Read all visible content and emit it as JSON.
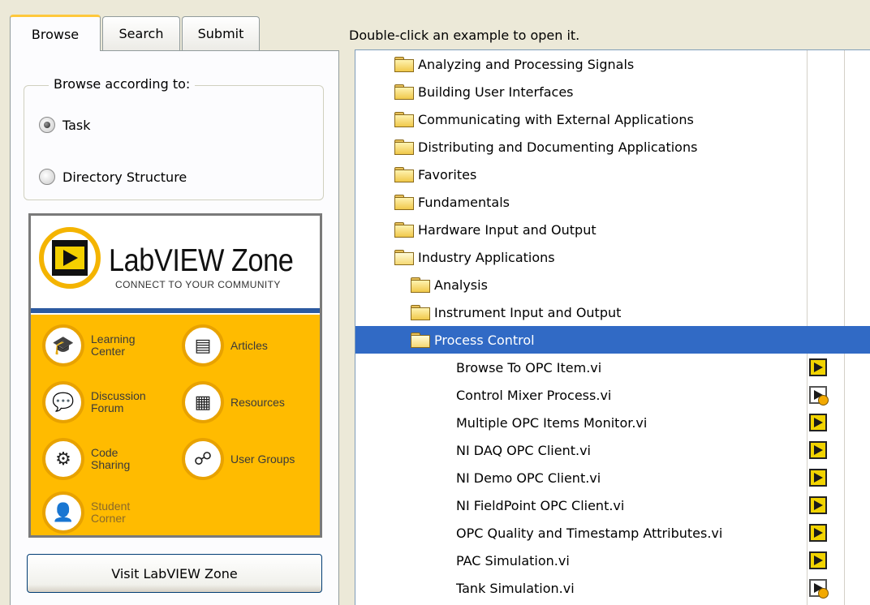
{
  "tabs": [
    {
      "label": "Browse",
      "active": true
    },
    {
      "label": "Search",
      "active": false
    },
    {
      "label": "Submit",
      "active": false
    }
  ],
  "browse": {
    "group_label": "Browse according to:",
    "options": [
      {
        "label": "Task",
        "checked": true
      },
      {
        "label": "Directory Structure",
        "checked": false
      }
    ]
  },
  "zone": {
    "title": "LabVIEW Zone",
    "subtitle": "CONNECT TO YOUR COMMUNITY",
    "items": [
      {
        "label": "Learning Center",
        "icon": "graduation-cap-icon"
      },
      {
        "label": "Articles",
        "icon": "document-icon"
      },
      {
        "label": "Discussion Forum",
        "icon": "chat-bubbles-icon"
      },
      {
        "label": "Resources",
        "icon": "folder-icon"
      },
      {
        "label": "Code Sharing",
        "icon": "gears-icon"
      },
      {
        "label": "User Groups",
        "icon": "people-icon"
      },
      {
        "label": "Student Corner",
        "icon": "student-icon"
      }
    ],
    "colors": {
      "accent": "#ffbb00",
      "band": "#2c5aa0"
    }
  },
  "visit_button": "Visit LabVIEW Zone",
  "instruction": "Double-click an example to open it.",
  "tree": {
    "selection_color": "#316ac5",
    "rows": [
      {
        "label": "Analyzing and Processing Signals",
        "level": 0,
        "type": "folder"
      },
      {
        "label": "Building User Interfaces",
        "level": 0,
        "type": "folder"
      },
      {
        "label": "Communicating with External Applications",
        "level": 0,
        "type": "folder"
      },
      {
        "label": "Distributing and Documenting Applications",
        "level": 0,
        "type": "folder"
      },
      {
        "label": "Favorites",
        "level": 0,
        "type": "folder"
      },
      {
        "label": "Fundamentals",
        "level": 0,
        "type": "folder"
      },
      {
        "label": "Hardware Input and Output",
        "level": 0,
        "type": "folder"
      },
      {
        "label": "Industry Applications",
        "level": 0,
        "type": "folder-open"
      },
      {
        "label": "Analysis",
        "level": 1,
        "type": "folder"
      },
      {
        "label": "Instrument Input and Output",
        "level": 1,
        "type": "folder"
      },
      {
        "label": "Process Control",
        "level": 1,
        "type": "folder-open",
        "selected": true
      },
      {
        "label": "Browse To OPC Item.vi",
        "level": 2,
        "type": "vi"
      },
      {
        "label": "Control Mixer Process.vi",
        "level": 2,
        "type": "vi-alt"
      },
      {
        "label": "Multiple OPC Items Monitor.vi",
        "level": 2,
        "type": "vi"
      },
      {
        "label": "NI DAQ OPC Client.vi",
        "level": 2,
        "type": "vi"
      },
      {
        "label": "NI Demo OPC Client.vi",
        "level": 2,
        "type": "vi"
      },
      {
        "label": "NI FieldPoint OPC Client.vi",
        "level": 2,
        "type": "vi"
      },
      {
        "label": "OPC Quality and Timestamp Attributes.vi",
        "level": 2,
        "type": "vi"
      },
      {
        "label": "PAC Simulation.vi",
        "level": 2,
        "type": "vi"
      },
      {
        "label": "Tank Simulation.vi",
        "level": 2,
        "type": "vi-alt"
      }
    ]
  }
}
